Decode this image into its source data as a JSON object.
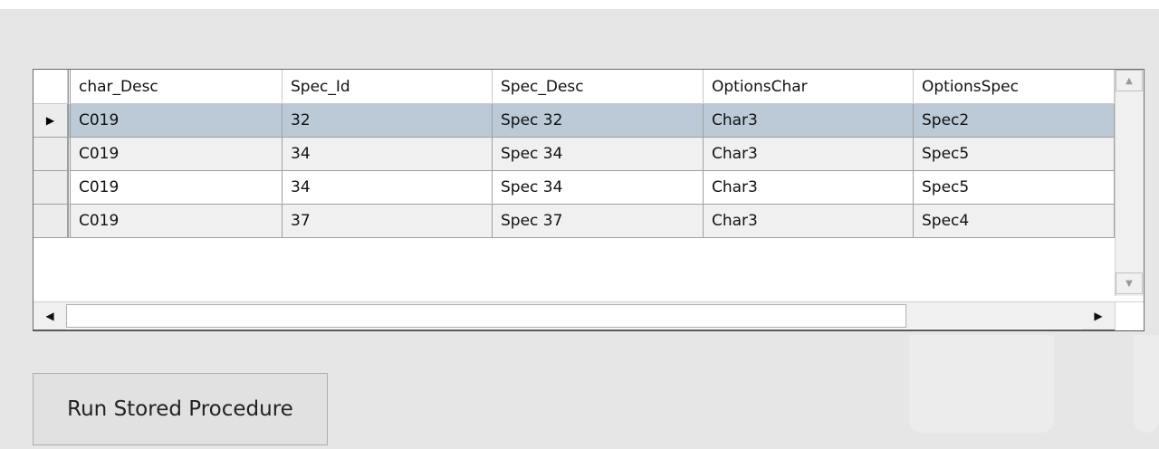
{
  "grid": {
    "columns": [
      "char_Desc",
      "Spec_Id",
      "Spec_Desc",
      "OptionsChar",
      "OptionsSpec"
    ],
    "current_row_indicator": "▶",
    "rows": [
      [
        "C019",
        "32",
        "Spec 32",
        "Char3",
        "Spec2"
      ],
      [
        "C019",
        "34",
        "Spec 34",
        "Char3",
        "Spec5"
      ],
      [
        "C019",
        "34",
        "Spec 34",
        "Char3",
        "Spec5"
      ],
      [
        "C019",
        "37",
        "Spec 37",
        "Char3",
        "Spec4"
      ]
    ],
    "selected_row_index": 0
  },
  "scrollbar_icons": {
    "up": "scroll-up-arrow-icon",
    "down": "scroll-down-arrow-icon",
    "left": "scroll-left-arrow-icon",
    "right": "scroll-right-arrow-icon"
  },
  "run_button_label": "Run Stored Procedure",
  "colors": {
    "form_background": "#e6e6e6",
    "selected_row": "#bccad8",
    "alternating_row": "#f0f0f0"
  }
}
